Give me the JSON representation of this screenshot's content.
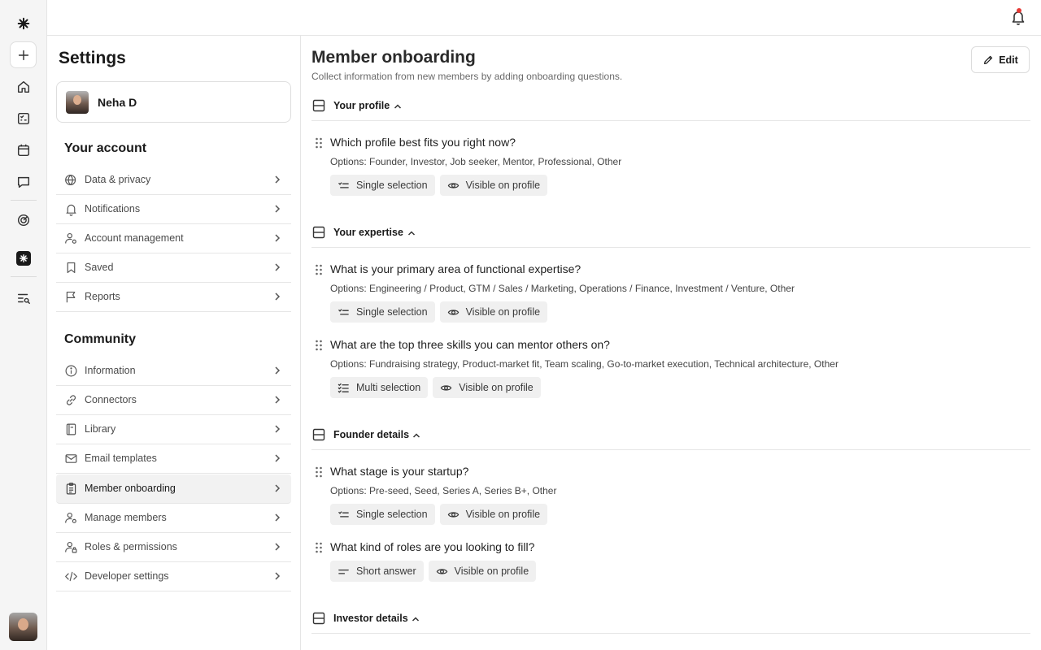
{
  "colors": {
    "accent": "#1a1a1a",
    "notification_dot": "#e53935",
    "chip_bg": "#f0f0f0",
    "border": "#e5e5e5"
  },
  "rail": {
    "icons": [
      "brand-logo-icon",
      "plus-icon",
      "home-icon",
      "tasks-icon",
      "calendar-icon",
      "chat-icon",
      "analytics-icon",
      "brand-app-icon",
      "search-list-icon"
    ]
  },
  "settings": {
    "title": "Settings",
    "profile_name": "Neha D",
    "account_heading": "Your account",
    "account_items": [
      {
        "label": "Data & privacy",
        "icon": "globe-shield-icon"
      },
      {
        "label": "Notifications",
        "icon": "bell-icon"
      },
      {
        "label": "Account management",
        "icon": "user-gear-icon"
      },
      {
        "label": "Saved",
        "icon": "bookmark-icon"
      },
      {
        "label": "Reports",
        "icon": "flag-icon"
      }
    ],
    "community_heading": "Community",
    "community_items": [
      {
        "label": "Information",
        "icon": "info-icon"
      },
      {
        "label": "Connectors",
        "icon": "link-icon"
      },
      {
        "label": "Library",
        "icon": "book-icon"
      },
      {
        "label": "Email templates",
        "icon": "mail-icon"
      },
      {
        "label": "Member onboarding",
        "icon": "clipboard-icon",
        "active": true
      },
      {
        "label": "Manage members",
        "icon": "user-gear-icon"
      },
      {
        "label": "Roles & permissions",
        "icon": "user-lock-icon"
      },
      {
        "label": "Developer settings",
        "icon": "code-icon"
      }
    ]
  },
  "main": {
    "title": "Member onboarding",
    "subtitle": "Collect information from new members by adding onboarding questions.",
    "edit_label": "Edit",
    "groups": [
      {
        "label": "Your profile"
      },
      {
        "label": "Your expertise"
      },
      {
        "label": "Founder details"
      },
      {
        "label": "Investor details"
      }
    ],
    "questions": [
      {
        "title": "Which profile best fits you right now?",
        "options": "Options: Founder, Investor, Job seeker, Mentor, Professional, Other",
        "type": "Single selection",
        "visibility": "Visible on profile"
      },
      {
        "title": "What is your primary area of functional expertise?",
        "options": "Options: Engineering / Product, GTM / Sales / Marketing, Operations / Finance, Investment / Venture, Other",
        "type": "Single selection",
        "visibility": "Visible on profile"
      },
      {
        "title": "What are the top three skills you can mentor others on?",
        "options": "Options: Fundraising strategy, Product-market fit, Team scaling, Go-to-market execution, Technical architecture, Other",
        "type": "Multi selection",
        "visibility": "Visible on profile"
      },
      {
        "title": "What stage is your startup?",
        "options": "Options: Pre-seed, Seed, Series A, Series B+, Other",
        "type": "Single selection",
        "visibility": "Visible on profile"
      },
      {
        "title": "What kind of roles are you looking to fill?",
        "type": "Short answer",
        "visibility": "Visible on profile"
      }
    ]
  }
}
